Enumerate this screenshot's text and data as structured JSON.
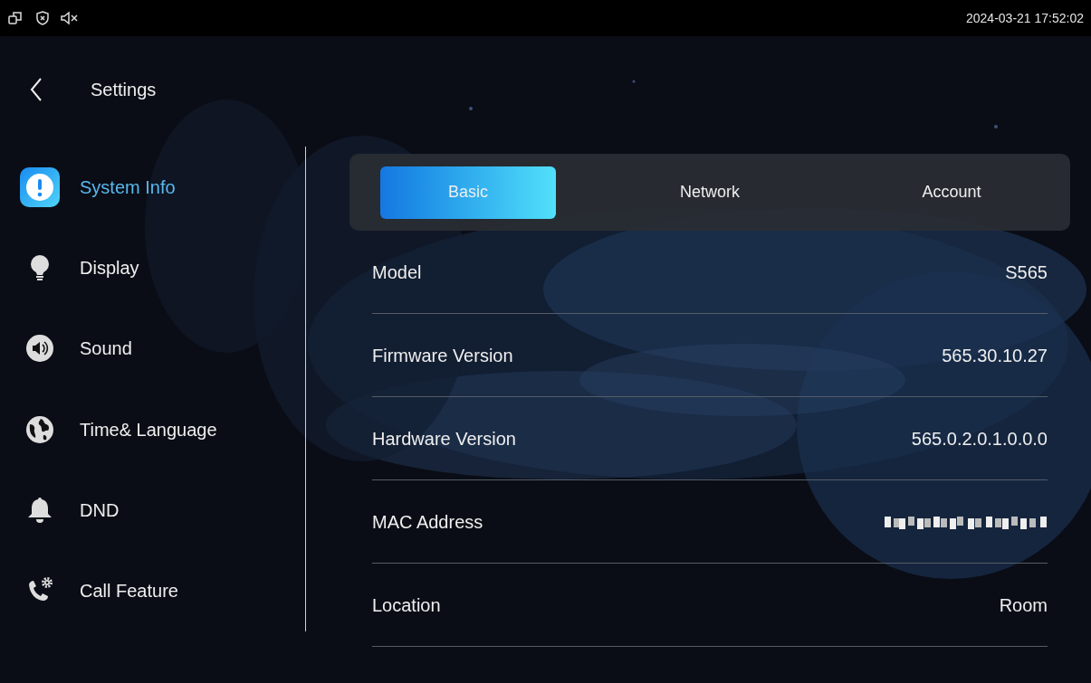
{
  "status_bar": {
    "time": "2024-03-21 17:52:02"
  },
  "header": {
    "title": "Settings"
  },
  "sidebar": {
    "items": [
      {
        "label": "System Info",
        "kind": "info",
        "selected": true
      },
      {
        "label": "Display",
        "kind": "bulb",
        "selected": false
      },
      {
        "label": "Sound",
        "kind": "speaker",
        "selected": false
      },
      {
        "label": "Time& Language",
        "kind": "globe",
        "selected": false
      },
      {
        "label": "DND",
        "kind": "bell",
        "selected": false
      },
      {
        "label": "Call Feature",
        "kind": "phone",
        "selected": false
      }
    ]
  },
  "tabs": [
    {
      "label": "Basic",
      "selected": true
    },
    {
      "label": "Network",
      "selected": false
    },
    {
      "label": "Account",
      "selected": false
    }
  ],
  "rows": [
    {
      "label": "Model",
      "value": "S565"
    },
    {
      "label": "Firmware Version",
      "value": "565.30.10.27"
    },
    {
      "label": "Hardware Version",
      "value": "565.0.2.0.1.0.0.0"
    },
    {
      "label": "MAC Address",
      "redacted": true
    },
    {
      "label": "Location",
      "value": "Room"
    }
  ]
}
